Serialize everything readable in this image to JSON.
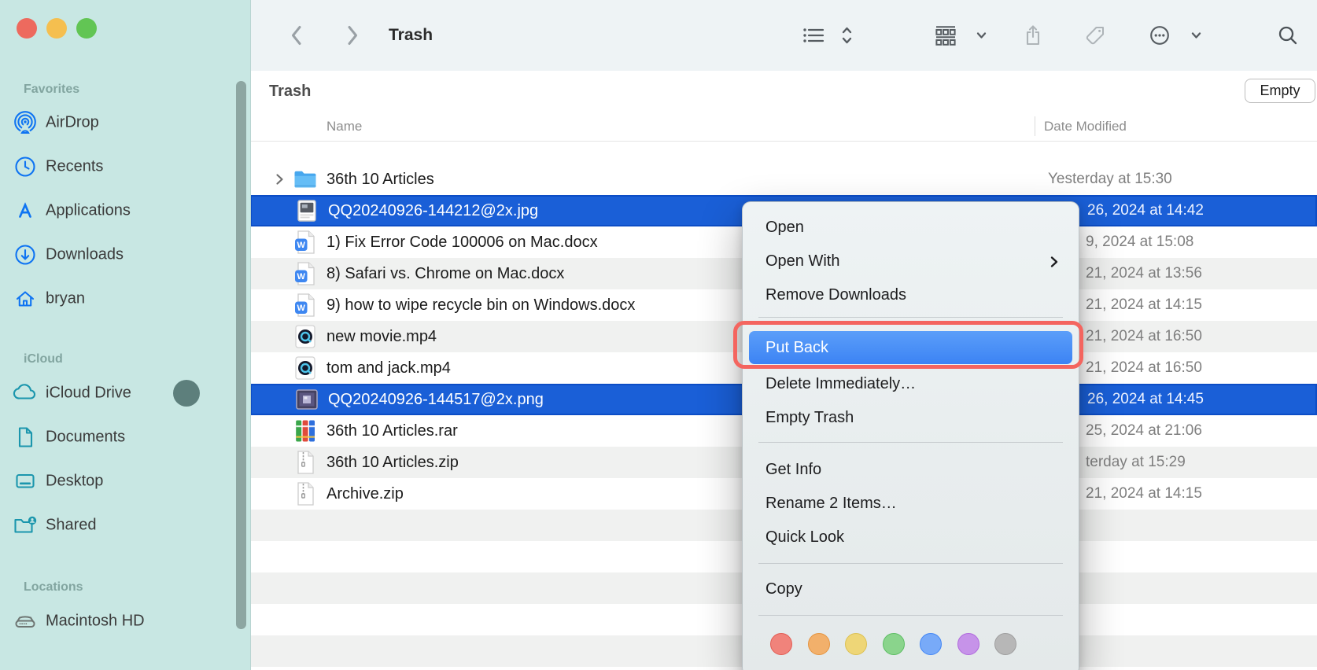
{
  "toolbar": {
    "title": "Trash",
    "buttons": [
      {
        "name": "back",
        "icon": "back-icon"
      },
      {
        "name": "forward",
        "icon": "forward-icon"
      },
      {
        "name": "list-view",
        "icon": "list-view-icon"
      },
      {
        "name": "sort-stack",
        "icon": "stack-chevrons-icon"
      },
      {
        "name": "group-view",
        "icon": "group-view-icon"
      },
      {
        "name": "share",
        "icon": "share-icon"
      },
      {
        "name": "tag",
        "icon": "tag-icon"
      },
      {
        "name": "more",
        "icon": "more-icon"
      },
      {
        "name": "search",
        "icon": "search-icon"
      }
    ]
  },
  "sidebar": {
    "sections": [
      {
        "label": "Favorites",
        "items": [
          {
            "label": "AirDrop",
            "icon": "airdrop-icon"
          },
          {
            "label": "Recents",
            "icon": "recents-icon"
          },
          {
            "label": "Applications",
            "icon": "applications-icon"
          },
          {
            "label": "Downloads",
            "icon": "downloads-icon"
          },
          {
            "label": "bryan",
            "icon": "home-icon"
          }
        ]
      },
      {
        "label": "iCloud",
        "items": [
          {
            "label": "iCloud Drive",
            "icon": "icloud-icon",
            "badge": "sync-status-circle"
          },
          {
            "label": "Documents",
            "icon": "document-icon"
          },
          {
            "label": "Desktop",
            "icon": "desktop-icon"
          },
          {
            "label": "Shared",
            "icon": "shared-folder-icon"
          }
        ]
      },
      {
        "label": "Locations",
        "items": [
          {
            "label": "Macintosh HD",
            "icon": "hard-drive-icon"
          }
        ]
      }
    ]
  },
  "content": {
    "section_title": "Trash",
    "empty_button_label": "Empty",
    "columns": [
      {
        "label": "Name"
      },
      {
        "label": "Date Modified"
      }
    ],
    "files": [
      {
        "name": "36th 10 Articles",
        "icon": "folder-icon",
        "expandable": true,
        "date": "Yesterday at 15:30",
        "selected": false
      },
      {
        "name": "QQ20240926-144212@2x.jpg",
        "icon": "image-jpg-icon",
        "date": "26, 2024 at 14:42",
        "selected": true
      },
      {
        "name": "1) Fix Error Code 100006 on Mac.docx",
        "icon": "word-doc-icon",
        "date": "9, 2024 at 15:08",
        "selected": false
      },
      {
        "name": "8) Safari vs. Chrome on Mac.docx",
        "icon": "word-doc-icon",
        "date": "21, 2024 at 13:56",
        "selected": false
      },
      {
        "name": "9) how to wipe recycle bin on Windows.docx",
        "icon": "word-doc-icon",
        "date": "21, 2024 at 14:15",
        "selected": false
      },
      {
        "name": "new movie.mp4",
        "icon": "video-icon",
        "date": "21, 2024 at 16:50",
        "selected": false
      },
      {
        "name": "tom and jack.mp4",
        "icon": "video-icon",
        "date": "21, 2024 at 16:50",
        "selected": false
      },
      {
        "name": "QQ20240926-144517@2x.png",
        "icon": "image-png-icon",
        "date": "26, 2024 at 14:45",
        "selected": true
      },
      {
        "name": "36th 10 Articles.rar",
        "icon": "archive-rar-icon",
        "date": "25, 2024 at 21:06",
        "selected": false
      },
      {
        "name": "36th 10 Articles.zip",
        "icon": "archive-zip-icon",
        "date": "terday at 15:29",
        "selected": false
      },
      {
        "name": "Archive.zip",
        "icon": "archive-zip-icon",
        "date": "21, 2024 at 14:15",
        "selected": false
      }
    ]
  },
  "context_menu": {
    "groups": [
      [
        {
          "label": "Open"
        },
        {
          "label": "Open With",
          "submenu": true
        },
        {
          "label": "Remove Downloads"
        }
      ],
      [
        {
          "label": "Put Back",
          "highlighted": true
        },
        {
          "label": "Delete Immediately…"
        },
        {
          "label": "Empty Trash"
        }
      ],
      [
        {
          "label": "Get Info"
        },
        {
          "label": "Rename 2 Items…"
        },
        {
          "label": "Quick Look"
        }
      ],
      [
        {
          "label": "Copy"
        }
      ]
    ],
    "tags": [
      {
        "name": "red",
        "fill": "#f0837b",
        "border": "#e25c53"
      },
      {
        "name": "orange",
        "fill": "#f2b06b",
        "border": "#e59440"
      },
      {
        "name": "yellow",
        "fill": "#eed677",
        "border": "#dcc153"
      },
      {
        "name": "green",
        "fill": "#8ad48c",
        "border": "#5cbd63"
      },
      {
        "name": "blue",
        "fill": "#78aaf8",
        "border": "#4286f5"
      },
      {
        "name": "purple",
        "fill": "#c693e9",
        "border": "#b069dd"
      },
      {
        "name": "gray",
        "fill": "#b7b7b7",
        "border": "#9e9e9e"
      }
    ]
  },
  "annotation": {
    "type": "highlight-box",
    "target": "Put Back",
    "color": "#f4655f"
  },
  "colors": {
    "sidebar_bg": "#c8e7e3",
    "row_stripe": "#f0f1f0",
    "selection_fill": "#1a5fd7",
    "selection_border": "#0c4dc6",
    "menu_highlight": "#4a90f6"
  }
}
